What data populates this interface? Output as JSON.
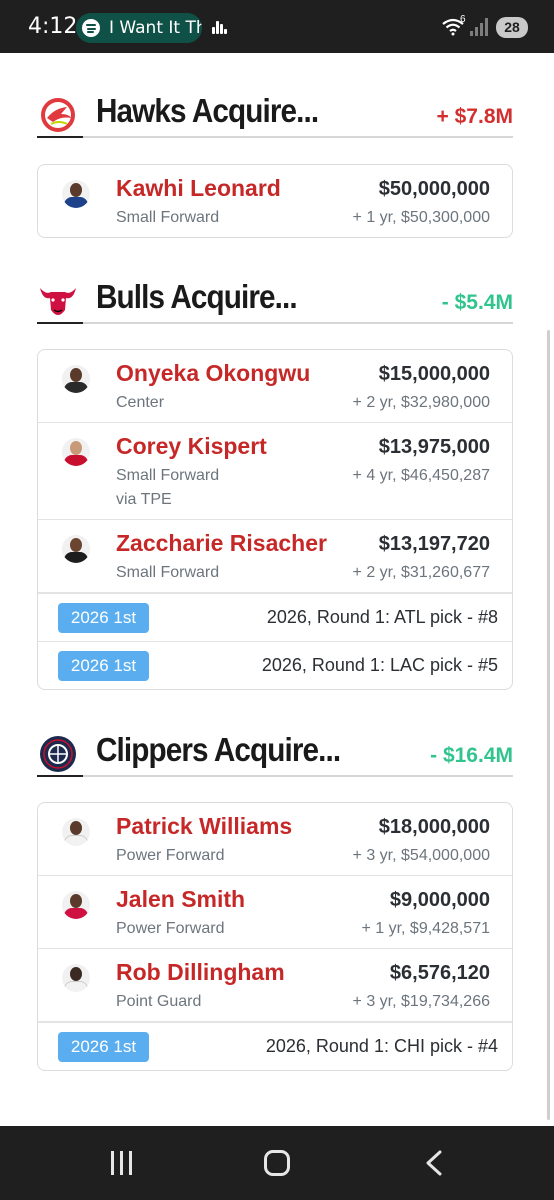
{
  "status_bar": {
    "time": "4:12",
    "now_playing": "I Want It Th",
    "battery": "28",
    "network": "6"
  },
  "colors": {
    "player_name": "#c62828",
    "positive_net": "#d32f2f",
    "negative_net": "#31c48d",
    "pick_badge": "#5aaef0"
  },
  "sections": [
    {
      "team": "Hawks",
      "title": "Hawks Acquire...",
      "net": "+ $7.8M",
      "logo_icon": "hawks-logo-icon",
      "players": [
        {
          "name": "Kawhi Leonard",
          "position": "Small Forward",
          "salary": "$50,000,000",
          "contract": "+ 1 yr, $50,300,000"
        }
      ],
      "picks": []
    },
    {
      "team": "Bulls",
      "title": "Bulls Acquire...",
      "net": "- $5.4M",
      "logo_icon": "bulls-logo-icon",
      "players": [
        {
          "name": "Onyeka Okongwu",
          "position": "Center",
          "salary": "$15,000,000",
          "contract": "+ 2 yr, $32,980,000"
        },
        {
          "name": "Corey Kispert",
          "position": "Small Forward",
          "via": "via TPE",
          "salary": "$13,975,000",
          "contract": "+ 4 yr, $46,450,287"
        },
        {
          "name": "Zaccharie Risacher",
          "position": "Small Forward",
          "salary": "$13,197,720",
          "contract": "+ 2 yr, $31,260,677"
        }
      ],
      "picks": [
        {
          "badge": "2026 1st",
          "description": "2026, Round 1: ATL pick - #8"
        },
        {
          "badge": "2026 1st",
          "description": "2026, Round 1: LAC pick - #5"
        }
      ]
    },
    {
      "team": "Clippers",
      "title": "Clippers Acquire...",
      "net": "- $16.4M",
      "logo_icon": "clippers-logo-icon",
      "players": [
        {
          "name": "Patrick Williams",
          "position": "Power Forward",
          "salary": "$18,000,000",
          "contract": "+ 3 yr, $54,000,000"
        },
        {
          "name": "Jalen Smith",
          "position": "Power Forward",
          "salary": "$9,000,000",
          "contract": "+ 1 yr, $9,428,571"
        },
        {
          "name": "Rob Dillingham",
          "position": "Point Guard",
          "salary": "$6,576,120",
          "contract": "+ 3 yr, $19,734,266"
        }
      ],
      "picks": [
        {
          "badge": "2026 1st",
          "description": "2026, Round 1: CHI pick - #4"
        }
      ]
    }
  ]
}
